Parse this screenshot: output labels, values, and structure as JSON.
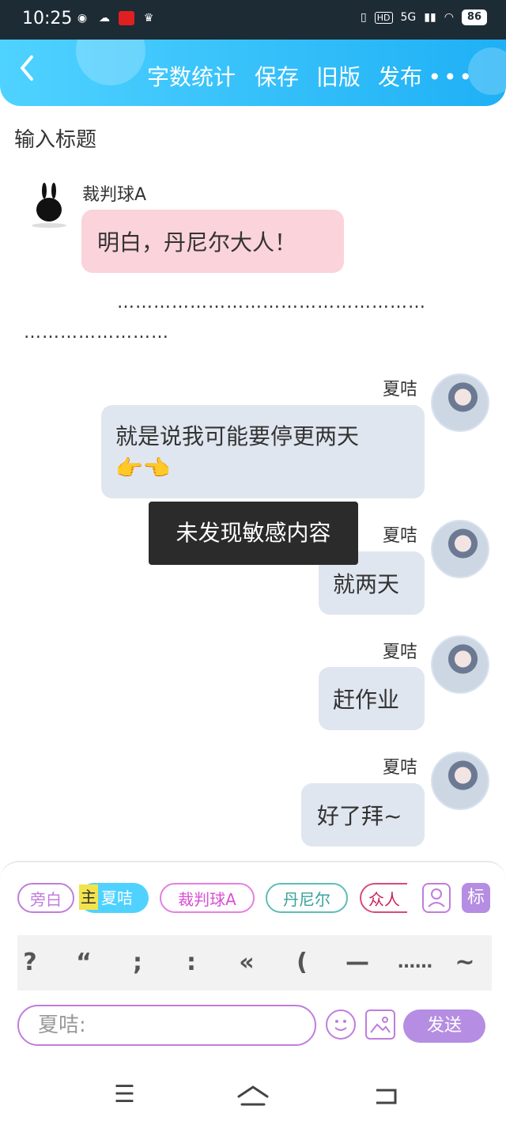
{
  "status_bar": {
    "time": "10:25",
    "network": "5G",
    "battery": "86"
  },
  "toolbar": {
    "back_icon": "chevron-left-icon",
    "word_count": "字数统计",
    "save": "保存",
    "old_version": "旧版",
    "publish": "发布",
    "more": "•••"
  },
  "title_placeholder": "输入标题",
  "messages": [
    {
      "speaker": "裁判球A",
      "text": "明白，丹尼尔大人！"
    },
    {
      "speaker": "夏咭",
      "text": "就是说我可能要停更两天",
      "emoji": "👉👈"
    },
    {
      "speaker": "夏咭",
      "text": "就两天"
    },
    {
      "speaker": "夏咭",
      "text": "赶作业"
    },
    {
      "speaker": "夏咭",
      "text": "好了拜~"
    }
  ],
  "ellipsis_line1": "……………………………………………",
  "ellipsis_line2": "……………………",
  "tooltip": "未发现敏感内容",
  "role_chips": {
    "narrator": "旁白",
    "main_tag": "主",
    "main": "夏咭",
    "referee": "裁判球A",
    "daniel": "丹尼尔",
    "crowd": "众人",
    "tag": "标"
  },
  "punctuation": [
    "?",
    "“",
    ";",
    ":",
    "«",
    "(",
    "—",
    "……",
    "~"
  ],
  "input": {
    "placeholder": "夏咭:"
  },
  "send": "发送",
  "colors": {
    "header": "#1fb0f5",
    "accent": "#b58de2",
    "pink_bubble": "#fbd3da",
    "grey_bubble": "#e0e6ef"
  }
}
